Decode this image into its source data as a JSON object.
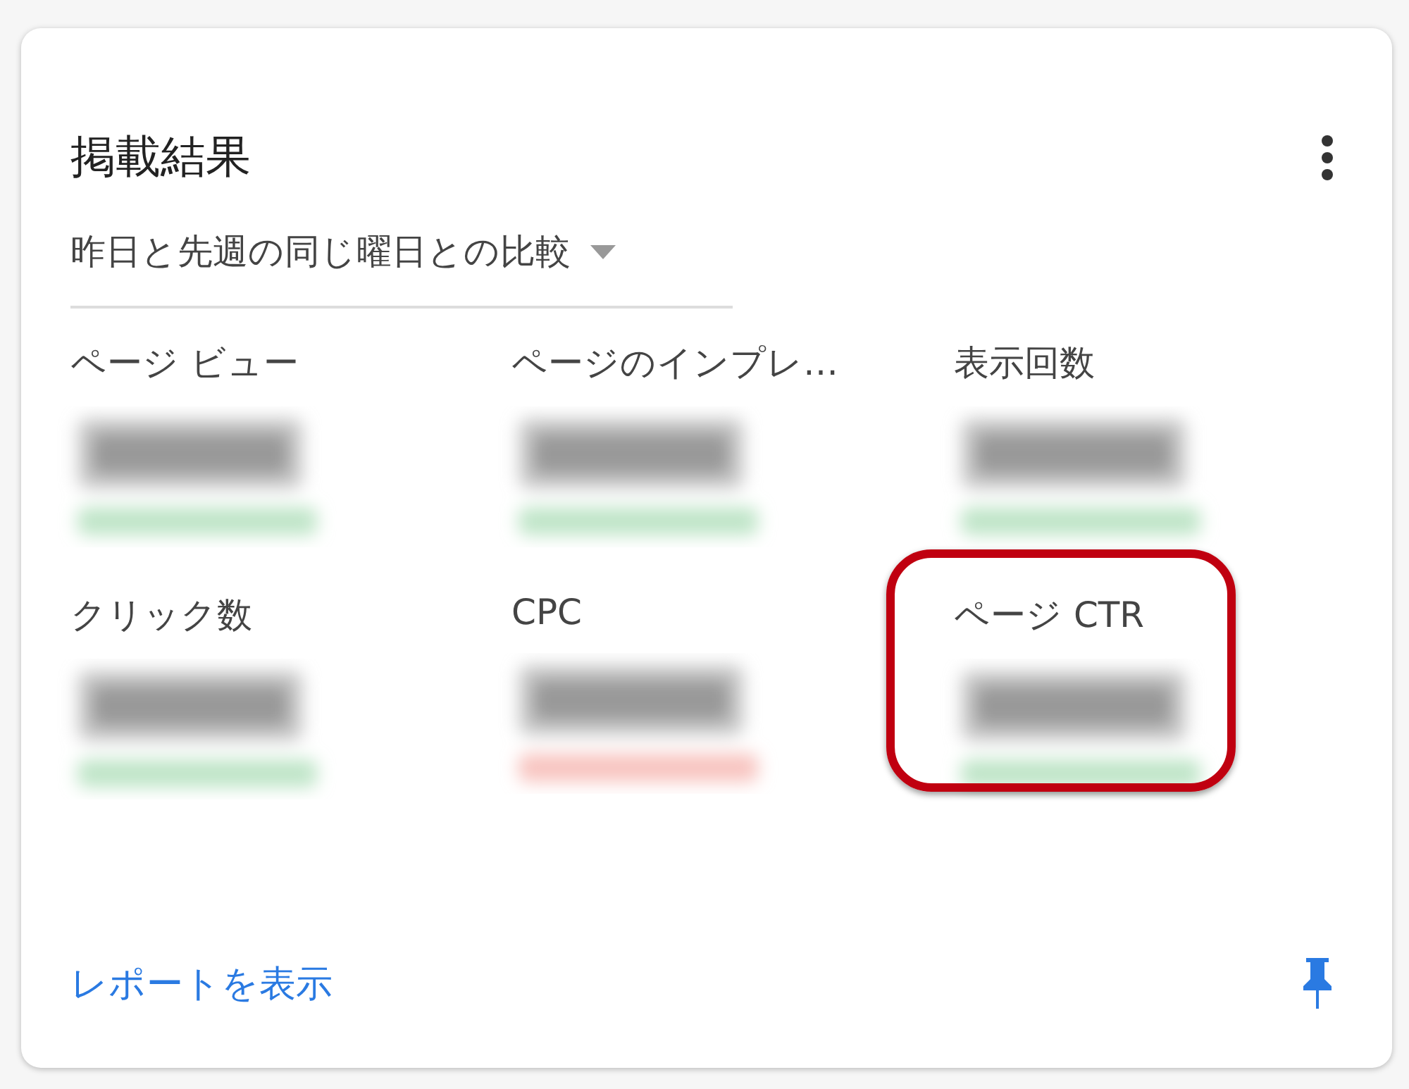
{
  "card": {
    "title": "掲載結果",
    "comparison": {
      "label": "昨日と先週の同じ曜日との比較"
    },
    "metrics": [
      {
        "label": "ページ ビュー",
        "color": "#bfe5c8",
        "highlighted": false
      },
      {
        "label": "ページのインプレ…",
        "color": "#bfe5c8",
        "highlighted": false
      },
      {
        "label": "表示回数",
        "color": "#bfe5c8",
        "highlighted": false
      },
      {
        "label": "クリック数",
        "color": "#bfe5c8",
        "highlighted": false
      },
      {
        "label": "CPC",
        "color": "#f8c4c0",
        "highlighted": false
      },
      {
        "label": "ページ CTR",
        "color": "#bfe5c8",
        "highlighted": true
      }
    ],
    "footer": {
      "link": "レポートを表示"
    }
  }
}
